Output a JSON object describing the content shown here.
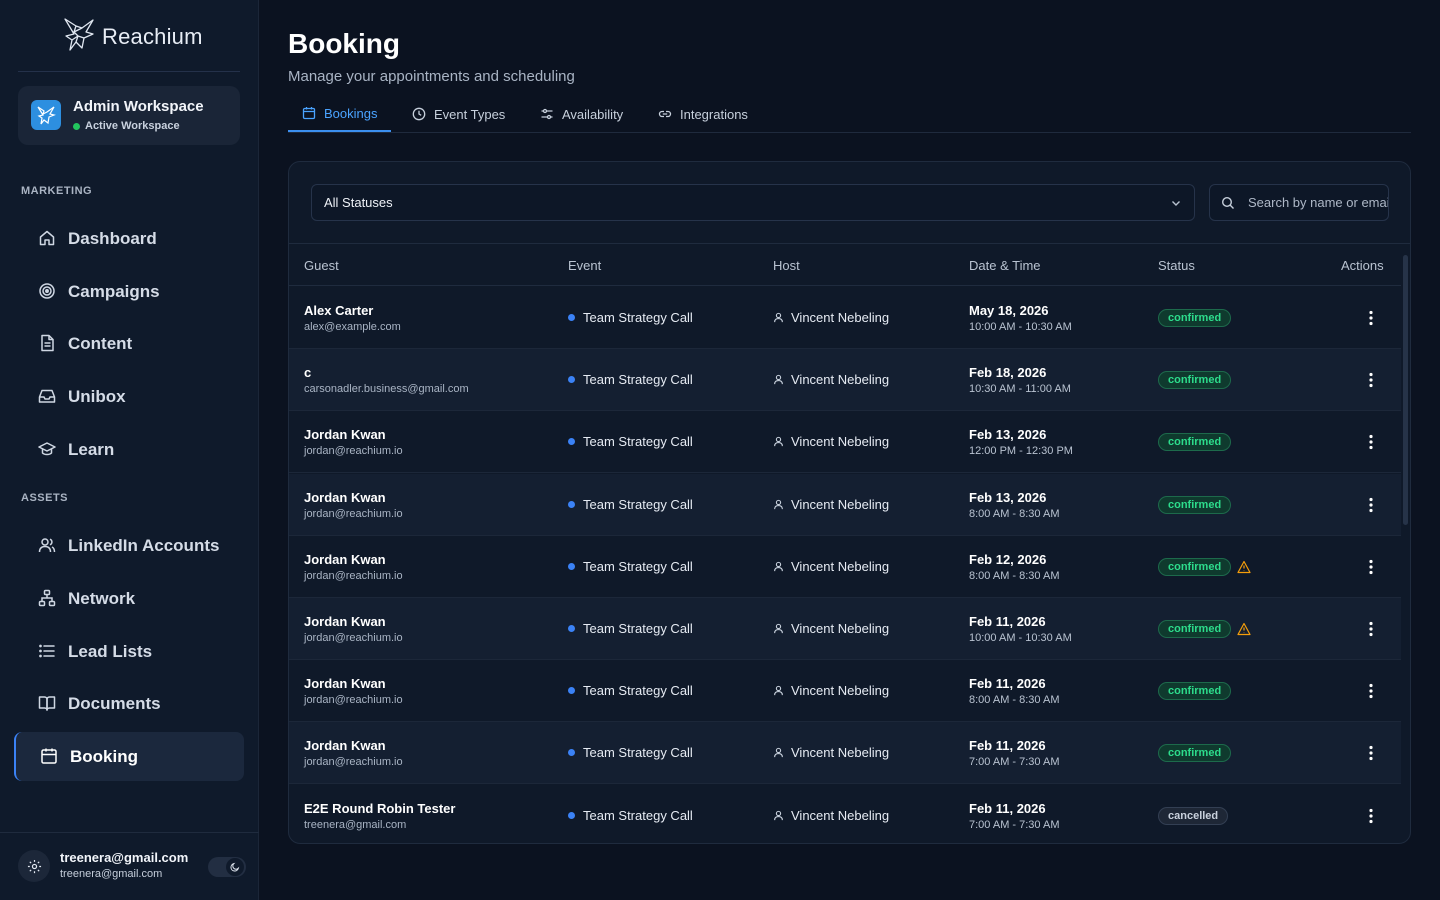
{
  "brand": {
    "name": "Reachium"
  },
  "workspace": {
    "title": "Admin Workspace",
    "status": "Active Workspace"
  },
  "sidebar": {
    "sections": [
      {
        "label": "MARKETING"
      },
      {
        "label": "ASSETS"
      }
    ],
    "items": [
      {
        "label": "Dashboard",
        "icon": "home-icon"
      },
      {
        "label": "Campaigns",
        "icon": "target-icon"
      },
      {
        "label": "Content",
        "icon": "document-icon"
      },
      {
        "label": "Unibox",
        "icon": "inbox-icon"
      },
      {
        "label": "Learn",
        "icon": "graduation-cap-icon"
      },
      {
        "label": "LinkedIn Accounts",
        "icon": "users-icon"
      },
      {
        "label": "Network",
        "icon": "network-icon"
      },
      {
        "label": "Lead Lists",
        "icon": "list-icon"
      },
      {
        "label": "Documents",
        "icon": "book-icon"
      },
      {
        "label": "Booking",
        "icon": "calendar-icon",
        "active": true
      }
    ]
  },
  "user": {
    "email": "treenera@gmail.com",
    "subtitle": "treenera@gmail.com"
  },
  "header": {
    "title": "Booking",
    "subtitle": "Manage your appointments and scheduling"
  },
  "tabs": [
    {
      "label": "Bookings",
      "icon": "calendar-icon",
      "active": true
    },
    {
      "label": "Event Types",
      "icon": "clock-icon"
    },
    {
      "label": "Availability",
      "icon": "sliders-icon"
    },
    {
      "label": "Integrations",
      "icon": "link-icon"
    }
  ],
  "filters": {
    "status_value": "All Statuses",
    "search_placeholder": "Search by name or email"
  },
  "table": {
    "columns": [
      "Guest",
      "Event",
      "Host",
      "Date & Time",
      "Status",
      "Actions"
    ],
    "rows": [
      {
        "name": "Alex Carter",
        "email": "alex@example.com",
        "event": "Team Strategy Call",
        "host": "Vincent Nebeling",
        "date": "May 18, 2026",
        "time": "10:00 AM - 10:30 AM",
        "status": "confirmed",
        "warning": false
      },
      {
        "name": "c",
        "email": "carsonadler.business@gmail.com",
        "event": "Team Strategy Call",
        "host": "Vincent Nebeling",
        "date": "Feb 18, 2026",
        "time": "10:30 AM - 11:00 AM",
        "status": "confirmed",
        "warning": false
      },
      {
        "name": "Jordan Kwan",
        "email": "jordan@reachium.io",
        "event": "Team Strategy Call",
        "host": "Vincent Nebeling",
        "date": "Feb 13, 2026",
        "time": "12:00 PM - 12:30 PM",
        "status": "confirmed",
        "warning": false
      },
      {
        "name": "Jordan Kwan",
        "email": "jordan@reachium.io",
        "event": "Team Strategy Call",
        "host": "Vincent Nebeling",
        "date": "Feb 13, 2026",
        "time": "8:00 AM - 8:30 AM",
        "status": "confirmed",
        "warning": false
      },
      {
        "name": "Jordan Kwan",
        "email": "jordan@reachium.io",
        "event": "Team Strategy Call",
        "host": "Vincent Nebeling",
        "date": "Feb 12, 2026",
        "time": "8:00 AM - 8:30 AM",
        "status": "confirmed",
        "warning": true
      },
      {
        "name": "Jordan Kwan",
        "email": "jordan@reachium.io",
        "event": "Team Strategy Call",
        "host": "Vincent Nebeling",
        "date": "Feb 11, 2026",
        "time": "10:00 AM - 10:30 AM",
        "status": "confirmed",
        "warning": true
      },
      {
        "name": "Jordan Kwan",
        "email": "jordan@reachium.io",
        "event": "Team Strategy Call",
        "host": "Vincent Nebeling",
        "date": "Feb 11, 2026",
        "time": "8:00 AM - 8:30 AM",
        "status": "confirmed",
        "warning": false
      },
      {
        "name": "Jordan Kwan",
        "email": "jordan@reachium.io",
        "event": "Team Strategy Call",
        "host": "Vincent Nebeling",
        "date": "Feb 11, 2026",
        "time": "7:00 AM - 7:30 AM",
        "status": "confirmed",
        "warning": false
      },
      {
        "name": "E2E Round Robin Tester",
        "email": "treenera@gmail.com",
        "event": "Team Strategy Call",
        "host": "Vincent Nebeling",
        "date": "Feb 11, 2026",
        "time": "7:00 AM - 7:30 AM",
        "status": "cancelled",
        "warning": false
      }
    ]
  },
  "colors": {
    "background": "#0b1220",
    "sidebar": "#0f1a2b",
    "accent": "#3b82f6",
    "confirmed": "#2ddc8c",
    "warning": "#f59e0b"
  }
}
